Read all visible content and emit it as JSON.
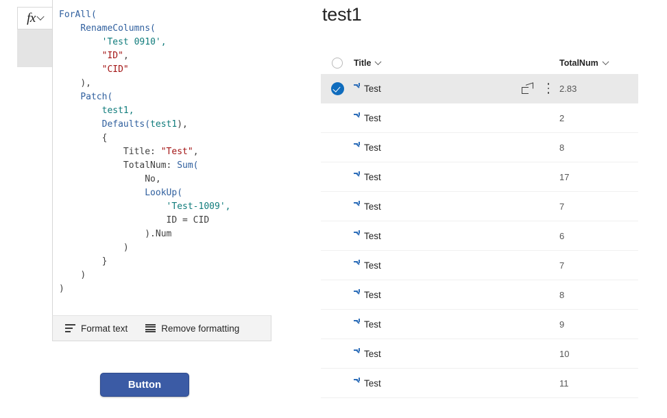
{
  "formula_pane": {
    "fx_button": {
      "glyph": "fx",
      "icon": "chevron-down-icon"
    },
    "code_lines": [
      [
        {
          "t": "ForAll(",
          "c": "fn"
        }
      ],
      [
        {
          "t": "    ",
          "c": "plain"
        },
        {
          "t": "RenameColumns(",
          "c": "fn"
        }
      ],
      [
        {
          "t": "        ",
          "c": "plain"
        },
        {
          "t": "'Test 0910',",
          "c": "ident"
        }
      ],
      [
        {
          "t": "        ",
          "c": "plain"
        },
        {
          "t": "\"ID\"",
          "c": "str"
        },
        {
          "t": ",",
          "c": "punc"
        }
      ],
      [
        {
          "t": "        ",
          "c": "plain"
        },
        {
          "t": "\"CID\"",
          "c": "str"
        }
      ],
      [
        {
          "t": "    ",
          "c": "plain"
        },
        {
          "t": "),",
          "c": "punc"
        }
      ],
      [
        {
          "t": "    ",
          "c": "plain"
        },
        {
          "t": "Patch(",
          "c": "fn"
        }
      ],
      [
        {
          "t": "        ",
          "c": "plain"
        },
        {
          "t": "test1,",
          "c": "ident"
        }
      ],
      [
        {
          "t": "        ",
          "c": "plain"
        },
        {
          "t": "Defaults(",
          "c": "fn"
        },
        {
          "t": "test1",
          "c": "ident"
        },
        {
          "t": "),",
          "c": "punc"
        }
      ],
      [
        {
          "t": "        {",
          "c": "punc"
        }
      ],
      [
        {
          "t": "            ",
          "c": "plain"
        },
        {
          "t": "Title: ",
          "c": "plain"
        },
        {
          "t": "\"Test\"",
          "c": "str"
        },
        {
          "t": ",",
          "c": "punc"
        }
      ],
      [
        {
          "t": "            ",
          "c": "plain"
        },
        {
          "t": "TotalNum: ",
          "c": "plain"
        },
        {
          "t": "Sum(",
          "c": "fn"
        }
      ],
      [
        {
          "t": "                ",
          "c": "plain"
        },
        {
          "t": "No,",
          "c": "plain"
        }
      ],
      [
        {
          "t": "                ",
          "c": "plain"
        },
        {
          "t": "LookUp(",
          "c": "fn"
        }
      ],
      [
        {
          "t": "                    ",
          "c": "plain"
        },
        {
          "t": "'Test-1009',",
          "c": "ident"
        }
      ],
      [
        {
          "t": "                    ",
          "c": "plain"
        },
        {
          "t": "ID = CID",
          "c": "plain"
        }
      ],
      [
        {
          "t": "                ",
          "c": "plain"
        },
        {
          "t": ").Num",
          "c": "plain"
        }
      ],
      [
        {
          "t": "            ",
          "c": "plain"
        },
        {
          "t": ")",
          "c": "punc"
        }
      ],
      [
        {
          "t": "        ",
          "c": "plain"
        },
        {
          "t": "}",
          "c": "punc"
        }
      ],
      [
        {
          "t": "    ",
          "c": "plain"
        },
        {
          "t": ")",
          "c": "punc"
        }
      ],
      [
        {
          "t": ")",
          "c": "punc"
        }
      ]
    ],
    "toolbar": {
      "format_text_label": "Format text",
      "format_text_icon": "format-text-icon",
      "remove_formatting_label": "Remove formatting",
      "remove_formatting_icon": "remove-formatting-icon"
    },
    "button_label": "Button",
    "button_color": "#3b5ba5"
  },
  "list_pane": {
    "title": "test1",
    "accent_color": "#0f6cbd",
    "selected_row_bg": "#e9e9e9",
    "columns": [
      {
        "label": "Title",
        "sort_icon": "chevron-down-icon"
      },
      {
        "label": "TotalNum",
        "sort_icon": "chevron-down-icon"
      }
    ],
    "select_all_icon": "select-all-circle-icon",
    "row_actions": {
      "share_icon": "share-icon",
      "more_icon": "more-vertical-icon"
    },
    "rows": [
      {
        "title": "Test",
        "total_num": "2.83",
        "selected": true,
        "new_indicator": "new-item-sparkle-icon"
      },
      {
        "title": "Test",
        "total_num": "2",
        "selected": false,
        "new_indicator": "new-item-sparkle-icon"
      },
      {
        "title": "Test",
        "total_num": "8",
        "selected": false,
        "new_indicator": "new-item-sparkle-icon"
      },
      {
        "title": "Test",
        "total_num": "17",
        "selected": false,
        "new_indicator": "new-item-sparkle-icon"
      },
      {
        "title": "Test",
        "total_num": "7",
        "selected": false,
        "new_indicator": "new-item-sparkle-icon"
      },
      {
        "title": "Test",
        "total_num": "6",
        "selected": false,
        "new_indicator": "new-item-sparkle-icon"
      },
      {
        "title": "Test",
        "total_num": "7",
        "selected": false,
        "new_indicator": "new-item-sparkle-icon"
      },
      {
        "title": "Test",
        "total_num": "8",
        "selected": false,
        "new_indicator": "new-item-sparkle-icon"
      },
      {
        "title": "Test",
        "total_num": "9",
        "selected": false,
        "new_indicator": "new-item-sparkle-icon"
      },
      {
        "title": "Test",
        "total_num": "10",
        "selected": false,
        "new_indicator": "new-item-sparkle-icon"
      },
      {
        "title": "Test",
        "total_num": "11",
        "selected": false,
        "new_indicator": "new-item-sparkle-icon"
      }
    ]
  }
}
